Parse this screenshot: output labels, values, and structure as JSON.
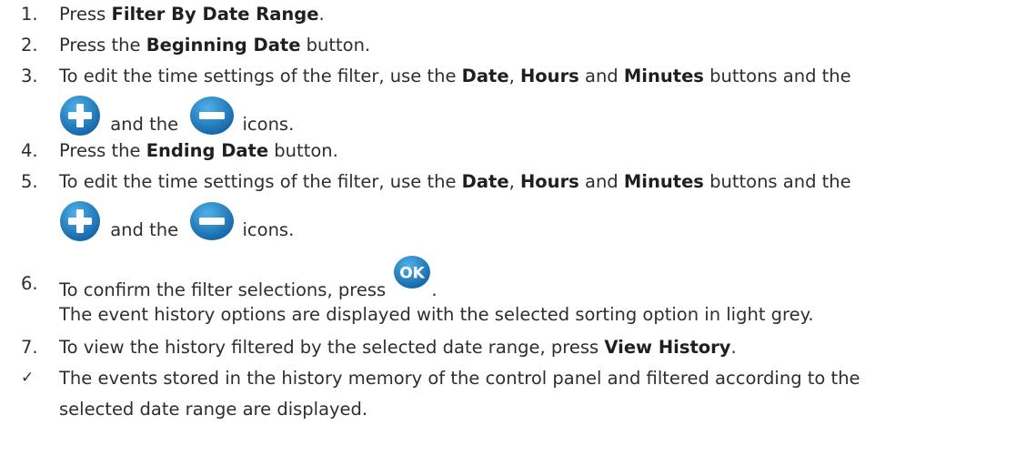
{
  "steps": [
    {
      "num": "1.",
      "pre": "Press ",
      "b1": "Filter By Date Range",
      "post": "."
    },
    {
      "num": "2.",
      "pre": "Press the ",
      "b1": "Beginning Date",
      "post": " button."
    },
    {
      "num": "3.",
      "pre": "To edit the time settings of the filter, use the ",
      "b1": "Date",
      "sep1": ", ",
      "b2": "Hours",
      "sep2": " and ",
      "b3": "Minutes",
      "post": " buttons and the",
      "line2_a": "and the",
      "line2_b": "icons."
    },
    {
      "num": "4.",
      "pre": "Press the ",
      "b1": "Ending Date",
      "post": " button."
    },
    {
      "num": "5.",
      "pre": "To edit the time settings of the filter, use the ",
      "b1": "Date",
      "sep1": ", ",
      "b2": "Hours",
      "sep2": " and ",
      "b3": "Minutes",
      "post": " buttons and the",
      "line2_a": "and the",
      "line2_b": "icons."
    },
    {
      "num": "6.",
      "pre": "To confirm the filter selections, press",
      "post": ".",
      "result": "The event history options are displayed with the selected sorting option in light grey."
    },
    {
      "num": "7.",
      "pre": "To view the history filtered by the selected date range, press ",
      "b1": "View History",
      "post": "."
    }
  ],
  "final": {
    "mark": "✓",
    "line1": "The events stored in the history memory of the control panel and filtered according to the",
    "line2": "selected date range are displayed."
  },
  "icons": {
    "plus": "plus-icon",
    "minus": "minus-icon",
    "ok": "ok-icon",
    "ok_label": "OK",
    "color": "#1b7fc2"
  }
}
